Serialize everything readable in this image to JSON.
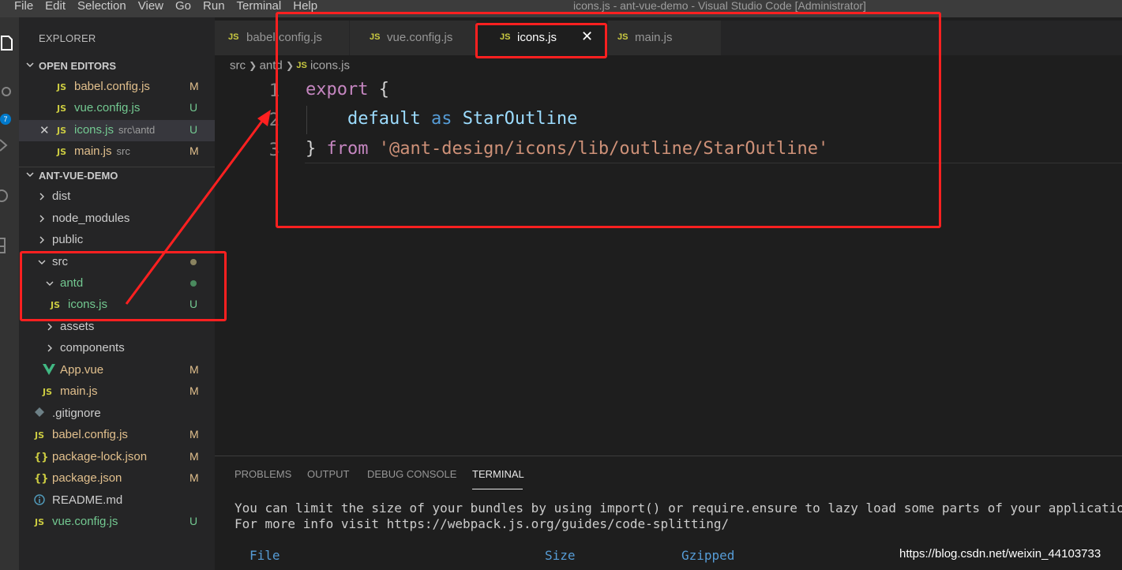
{
  "window": {
    "title": "icons.js - ant-vue-demo - Visual Studio Code [Administrator]",
    "menu": [
      "File",
      "Edit",
      "Selection",
      "View",
      "Go",
      "Run",
      "Terminal",
      "Help"
    ]
  },
  "activity_bar": {
    "icons": [
      "files-icon",
      "search-icon",
      "source-control-icon",
      "run-icon",
      "extensions-icon"
    ],
    "badge": "7"
  },
  "sidebar": {
    "title": "EXPLORER",
    "open_editors": {
      "header": "OPEN EDITORS",
      "items": [
        {
          "name": "babel.config.js",
          "hint": "",
          "status": "M"
        },
        {
          "name": "vue.config.js",
          "hint": "",
          "status": "U"
        },
        {
          "name": "icons.js",
          "hint": "src\\antd",
          "status": "U"
        },
        {
          "name": "main.js",
          "hint": "src",
          "status": "M"
        }
      ]
    },
    "project": {
      "header": "ANT-VUE-DEMO",
      "items": [
        {
          "name": "dist",
          "type": "folder",
          "status": ""
        },
        {
          "name": "node_modules",
          "type": "folder",
          "status": ""
        },
        {
          "name": "public",
          "type": "folder",
          "status": ""
        },
        {
          "name": "src",
          "type": "folder-open",
          "status": "dot"
        },
        {
          "name": "antd",
          "type": "folder-open",
          "status": "dot"
        },
        {
          "name": "icons.js",
          "type": "js",
          "status": "U"
        },
        {
          "name": "assets",
          "type": "folder",
          "status": ""
        },
        {
          "name": "components",
          "type": "folder",
          "status": ""
        },
        {
          "name": "App.vue",
          "type": "vue",
          "status": "M"
        },
        {
          "name": "main.js",
          "type": "js",
          "status": "M"
        },
        {
          "name": ".gitignore",
          "type": "git",
          "status": ""
        },
        {
          "name": "babel.config.js",
          "type": "js",
          "status": "M"
        },
        {
          "name": "package-lock.json",
          "type": "json",
          "status": "M"
        },
        {
          "name": "package.json",
          "type": "json",
          "status": "M"
        },
        {
          "name": "README.md",
          "type": "info",
          "status": ""
        },
        {
          "name": "vue.config.js",
          "type": "js",
          "status": "U"
        }
      ]
    }
  },
  "tabs": [
    {
      "label": "babel.config.js",
      "active": false
    },
    {
      "label": "vue.config.js",
      "active": false
    },
    {
      "label": "icons.js",
      "active": true
    },
    {
      "label": "main.js",
      "active": false
    }
  ],
  "tab_close": "✕",
  "breadcrumb": [
    "src",
    "antd",
    "icons.js"
  ],
  "editor": {
    "line_numbers": [
      "1",
      "2",
      "3"
    ],
    "line1": {
      "kw": "export",
      "brace": " {"
    },
    "line2": {
      "indent": "    ",
      "kw": "default",
      "as": " as ",
      "id": "StarOutline"
    },
    "line3": {
      "brace": "}",
      "kw": " from ",
      "str": "'@ant-design/icons/lib/outline/StarOutline'"
    }
  },
  "panel": {
    "tabs": [
      "PROBLEMS",
      "OUTPUT",
      "DEBUG CONSOLE",
      "TERMINAL"
    ],
    "terminal_lines": [
      "You can limit the size of your bundles by using import() or require.ensure to lazy load some parts of your applicatio",
      "For more info visit https://webpack.js.org/guides/code-splitting/"
    ],
    "table_headers": [
      "File",
      "Size",
      "Gzipped"
    ]
  },
  "watermark": "https://blog.csdn.net/weixin_44103733",
  "colors": {
    "annotation_red": "#ff2020",
    "modified": "#e2c08d",
    "untracked": "#73c991",
    "js_icon": "#cbcb41"
  }
}
